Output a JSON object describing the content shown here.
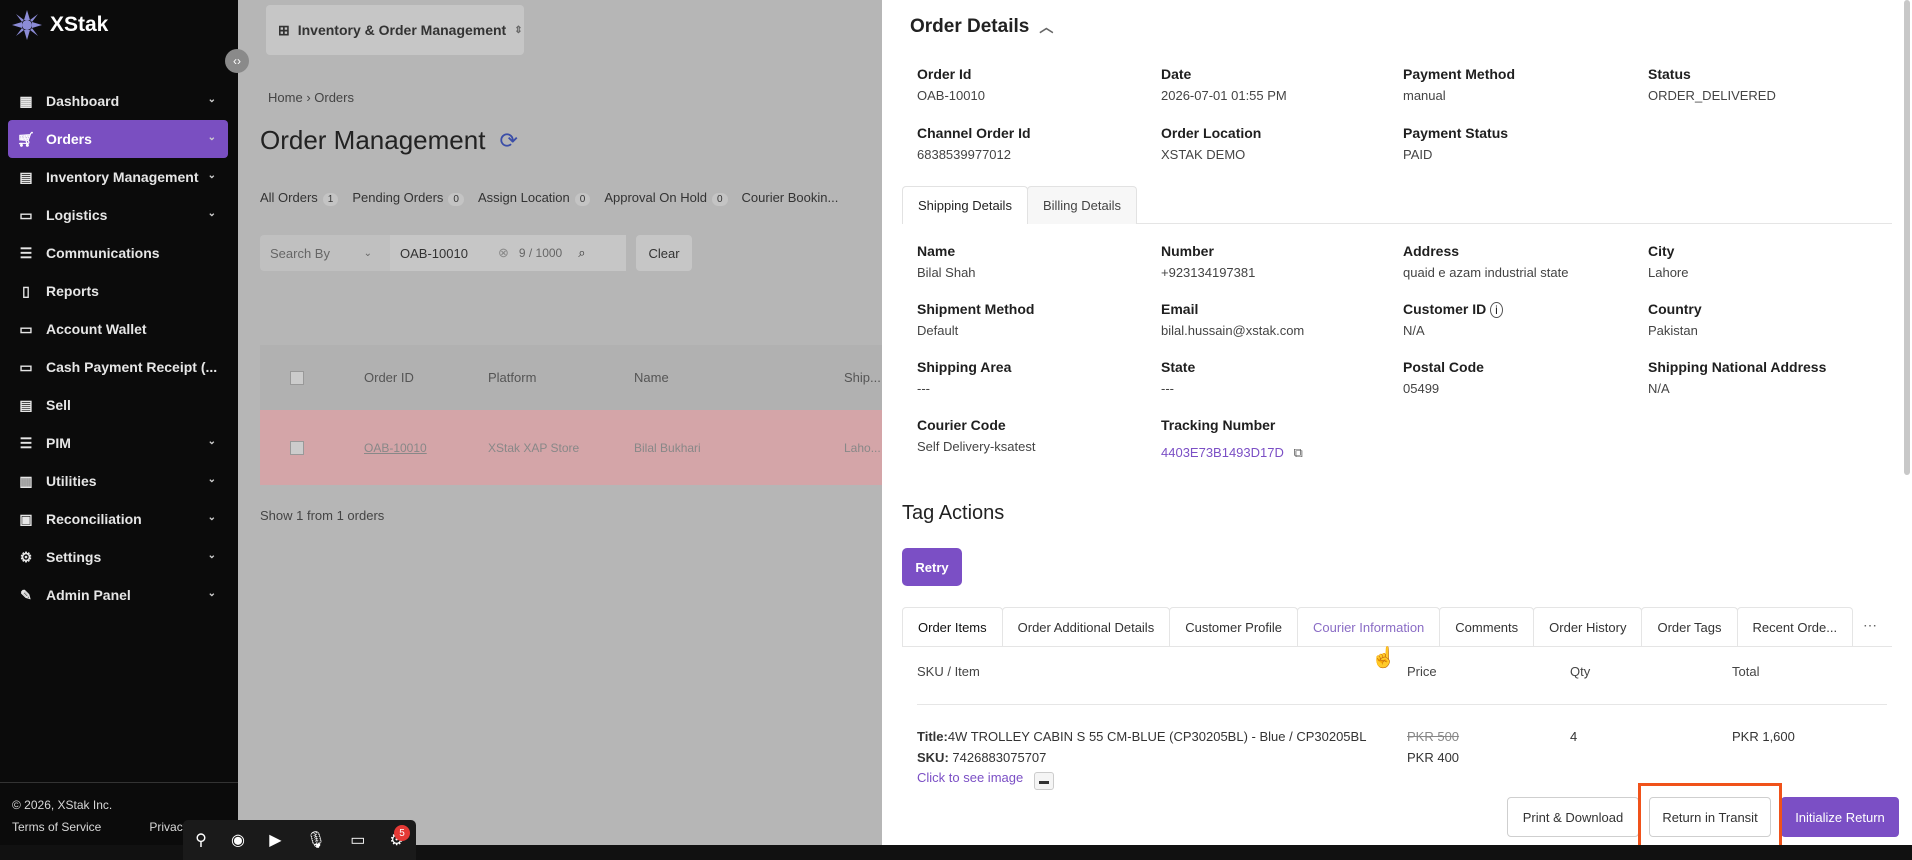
{
  "brand": {
    "name": "XStak"
  },
  "sidebar": {
    "items": [
      {
        "label": "Dashboard",
        "icon": "grid-icon",
        "has_chevron": true
      },
      {
        "label": "Orders",
        "icon": "cart-icon",
        "has_chevron": true,
        "active": true
      },
      {
        "label": "Inventory Management",
        "icon": "box-icon",
        "has_chevron": true
      },
      {
        "label": "Logistics",
        "icon": "truck-icon",
        "has_chevron": true
      },
      {
        "label": "Communications",
        "icon": "message-icon",
        "has_chevron": false
      },
      {
        "label": "Reports",
        "icon": "document-icon",
        "has_chevron": false
      },
      {
        "label": "Account Wallet",
        "icon": "wallet-icon",
        "has_chevron": false
      },
      {
        "label": "Cash Payment Receipt (...",
        "icon": "receipt-icon",
        "has_chevron": false
      },
      {
        "label": "Sell",
        "icon": "store-icon",
        "has_chevron": false
      },
      {
        "label": "PIM",
        "icon": "list-icon",
        "has_chevron": true
      },
      {
        "label": "Utilities",
        "icon": "tools-icon",
        "has_chevron": true
      },
      {
        "label": "Reconciliation",
        "icon": "balance-icon",
        "has_chevron": true
      },
      {
        "label": "Settings",
        "icon": "gear-icon",
        "has_chevron": true
      },
      {
        "label": "Admin Panel",
        "icon": "admin-icon",
        "has_chevron": true
      }
    ],
    "footer": {
      "copyright": "© 2026, XStak Inc.",
      "terms": "Terms of Service",
      "privacy": "Privacy P..."
    }
  },
  "main": {
    "app_selector": "Inventory & Order Management",
    "breadcrumb": [
      "Home",
      "Orders"
    ],
    "title": "Order Management",
    "tabs": [
      {
        "label": "All Orders",
        "count": "1"
      },
      {
        "label": "Pending Orders",
        "count": "0"
      },
      {
        "label": "Assign Location",
        "count": "0"
      },
      {
        "label": "Approval On Hold",
        "count": "0"
      },
      {
        "label": "Courier Bookin...",
        "count": ""
      }
    ],
    "search": {
      "by_placeholder": "Search By",
      "value": "OAB-10010",
      "counter": "9 / 1000",
      "clear_label": "Clear"
    },
    "table": {
      "headers": [
        "Order ID",
        "Platform",
        "Name",
        "Ship..."
      ],
      "row": {
        "order_id": "OAB-10010",
        "platform": "XStak XAP Store",
        "name": "Bilal Bukhari",
        "city": "Laho..."
      }
    },
    "footer_text": "Show 1 from 1 orders"
  },
  "order_details": {
    "title": "Order Details",
    "summary": [
      {
        "label": "Order Id",
        "value": "OAB-10010"
      },
      {
        "label": "Date",
        "value": "2026-07-01 01:55 PM"
      },
      {
        "label": "Payment Method",
        "value": "manual"
      },
      {
        "label": "Status",
        "value": "ORDER_DELIVERED"
      },
      {
        "label": "Channel Order Id",
        "value": "6838539977012"
      },
      {
        "label": "Order Location",
        "value": "XSTAK DEMO"
      },
      {
        "label": "Payment Status",
        "value": "PAID"
      }
    ],
    "detail_tabs": [
      "Shipping Details",
      "Billing Details"
    ],
    "shipping": [
      {
        "label": "Name",
        "value": "Bilal Shah"
      },
      {
        "label": "Number",
        "value": "+923134197381"
      },
      {
        "label": "Address",
        "value": "quaid e azam industrial state"
      },
      {
        "label": "City",
        "value": "Lahore"
      },
      {
        "label": "Shipment Method",
        "value": "Default"
      },
      {
        "label": "Email",
        "value": "bilal.hussain@xstak.com"
      },
      {
        "label": "Customer ID",
        "value": "N/A"
      },
      {
        "label": "Country",
        "value": "Pakistan"
      },
      {
        "label": "Shipping Area",
        "value": "---"
      },
      {
        "label": "State",
        "value": "---"
      },
      {
        "label": "Postal Code",
        "value": "05499"
      },
      {
        "label": "Shipping National Address",
        "value": "N/A"
      },
      {
        "label": "Courier Code",
        "value": "Self Delivery-ksatest"
      },
      {
        "label": "Tracking Number",
        "value": "4403E73B1493D17D"
      }
    ],
    "tag_actions": {
      "title": "Tag Actions",
      "retry_label": "Retry"
    },
    "item_tabs": [
      "Order Items",
      "Order Additional Details",
      "Customer Profile",
      "Courier Information",
      "Comments",
      "Order History",
      "Order Tags",
      "Recent Orde..."
    ],
    "items_headers": {
      "sku_item": "SKU / Item",
      "price": "Price",
      "qty": "Qty",
      "total": "Total"
    },
    "item": {
      "title_label": "Title:",
      "title": "4W TROLLEY CABIN S 55 CM-BLUE (CP30205BL) - Blue / CP30205BL",
      "sku_label": "SKU:",
      "sku": "7426883075707",
      "image_link": "Click to see image",
      "old_price": "PKR 500",
      "price": "PKR 400",
      "qty": "4",
      "total": "PKR 1,600"
    },
    "actions": {
      "print": "Print & Download",
      "return_transit": "Return in Transit",
      "initialize_return": "Initialize Return"
    }
  },
  "recorder": {
    "badge": "5"
  },
  "colors": {
    "accent": "#7b4fc5",
    "highlight": "#f0521a",
    "sidebar_bg": "#0b0b0b"
  }
}
